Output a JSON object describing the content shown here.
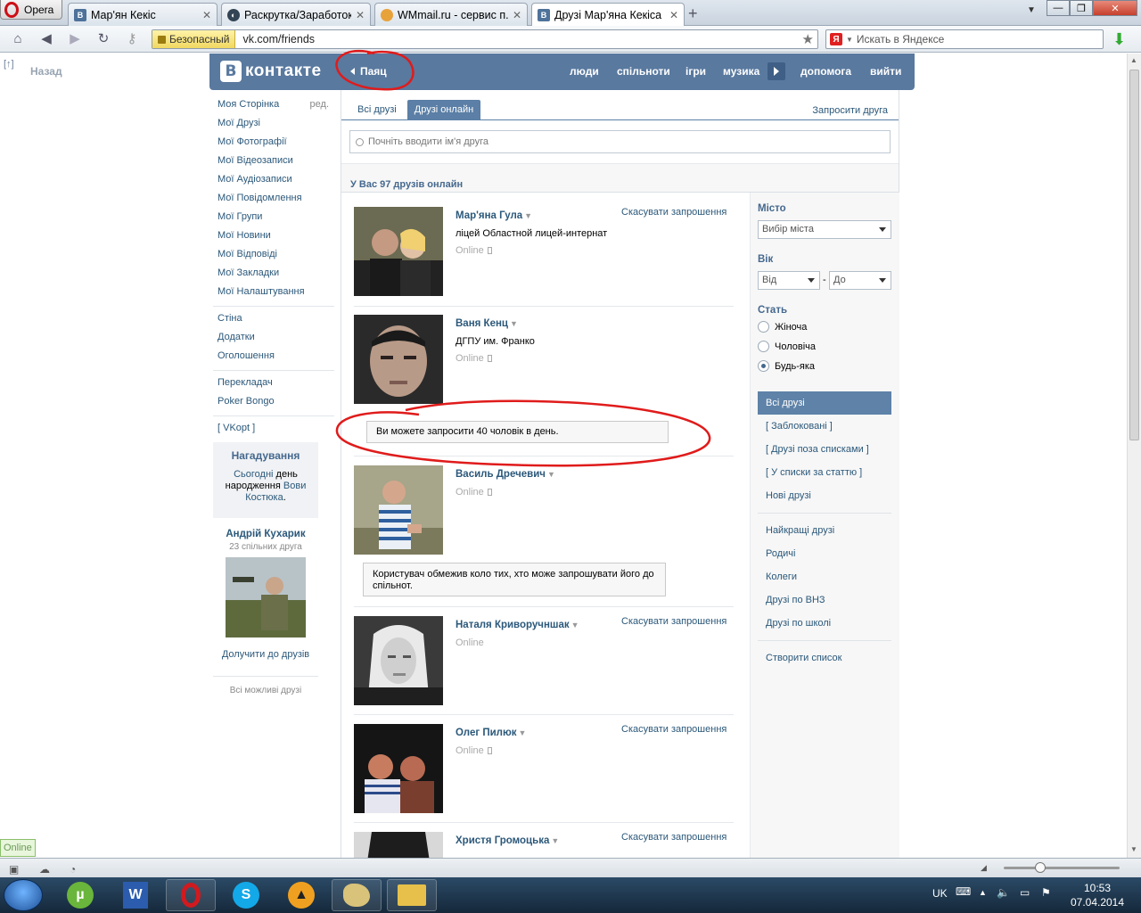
{
  "colors": {
    "vk_blue": "#59799f",
    "vk_link": "#2b587a",
    "annotation_red": "#e01b1b"
  },
  "browser": {
    "opera_label": "Opera",
    "tabs": [
      {
        "label": "Мар'ян Кекіс",
        "icon": "vk-favicon"
      },
      {
        "label": "Раскрутка/Заработок ...",
        "icon": "site-favicon"
      },
      {
        "label": "WMmail.ru - сервис п...",
        "icon": "wmmail-favicon"
      },
      {
        "label": "Друзі Мар'яна Кекіса |...",
        "icon": "vk-favicon",
        "active": true
      }
    ],
    "secure_label": "Безопасный",
    "url": "vk.com/friends",
    "search_placeholder": "Искать в Яндексе",
    "back_label": "Назад",
    "back_hint": "[↑]"
  },
  "vk_header": {
    "logo_text": "контакте",
    "back_name": "Паяц",
    "nav": [
      "люди",
      "спільноти",
      "ігри",
      "музика",
      "допомога",
      "вийти"
    ]
  },
  "left_menu": {
    "edit_label": "ред.",
    "group1": [
      "Моя Сторінка",
      "Мої Друзі",
      "Мої Фотографії",
      "Мої Відеозаписи",
      "Мої Аудіозаписи",
      "Мої Повідомлення",
      "Мої Групи",
      "Мої Новини",
      "Мої Відповіді",
      "Мої Закладки",
      "Мої Налаштування"
    ],
    "group2": [
      "Стіна",
      "Додатки",
      "Оголошення"
    ],
    "group3": [
      "Перекладач",
      "Poker Bongo"
    ],
    "group4": [
      "[ VKopt ]"
    ]
  },
  "reminder": {
    "title": "Нагадування",
    "p1": "Сьогодні",
    "p2": " день народження ",
    "p3": "Вови Костюка",
    "p4": "."
  },
  "suggestion": {
    "name": "Андрій Кухарик",
    "mutual": "23 спільних друга",
    "add_label": "Долучити до друзів",
    "all_label": "Всі можливі друзі"
  },
  "main": {
    "tab_all": "Всі друзі",
    "tab_online": "Друзі онлайн",
    "invite": "Запросити друга",
    "search_placeholder": "Почніть вводити ім'я друга",
    "count_label": "У Вас 97 друзів онлайн",
    "cancel_label": "Скасувати запрошення",
    "online_label": "Online",
    "friends": [
      {
        "name": "Мар'яна Гула",
        "sub": "лiцей Областной лицей-интернат",
        "has_cancel": true
      },
      {
        "name": "Ваня Кенц",
        "sub": "ДГПУ им. Франко",
        "has_cancel": false
      },
      {
        "name": "Василь Дречевич",
        "sub": "",
        "has_cancel": false
      },
      {
        "name": "Наталя Криворучншак",
        "sub": "",
        "has_cancel": true
      },
      {
        "name": "Олег Пилюк",
        "sub": "",
        "has_cancel": true
      },
      {
        "name": "Христя Громоцька",
        "sub": "",
        "has_cancel": true
      }
    ],
    "msg_limit": "Ви можете запросити 40 чоловік в день.",
    "msg_restricted": "Користувач обмежив коло тих, хто може запрошувати його до спільнот."
  },
  "filters": {
    "city_label": "Місто",
    "city_select": "Вибір міста",
    "age_label": "Вік",
    "age_from": "Від",
    "age_dash": "-",
    "age_to": "До",
    "sex_label": "Стать",
    "sex_options": [
      "Жіноча",
      "Чоловіча",
      "Будь-яка"
    ],
    "sex_selected_index": 2,
    "lists_a": [
      "Всі друзі",
      "[ Заблоковані ]",
      "[ Друзі поза списками ]",
      "[ У списки за статтю ]",
      "Нові друзі"
    ],
    "lists_b": [
      "Найкращі друзі",
      "Родичі",
      "Колеги",
      "Друзі по ВНЗ",
      "Друзі по школі"
    ],
    "create_list": "Створити список"
  },
  "status": {
    "online_badge": "Online"
  },
  "taskbar": {
    "lang": "UK",
    "time": "10:53",
    "date": "07.04.2014",
    "apps": [
      "utorrent-icon",
      "word-icon",
      "opera-icon",
      "skype-icon",
      "aimp-icon",
      "paint-icon",
      "explorer-icon"
    ]
  }
}
